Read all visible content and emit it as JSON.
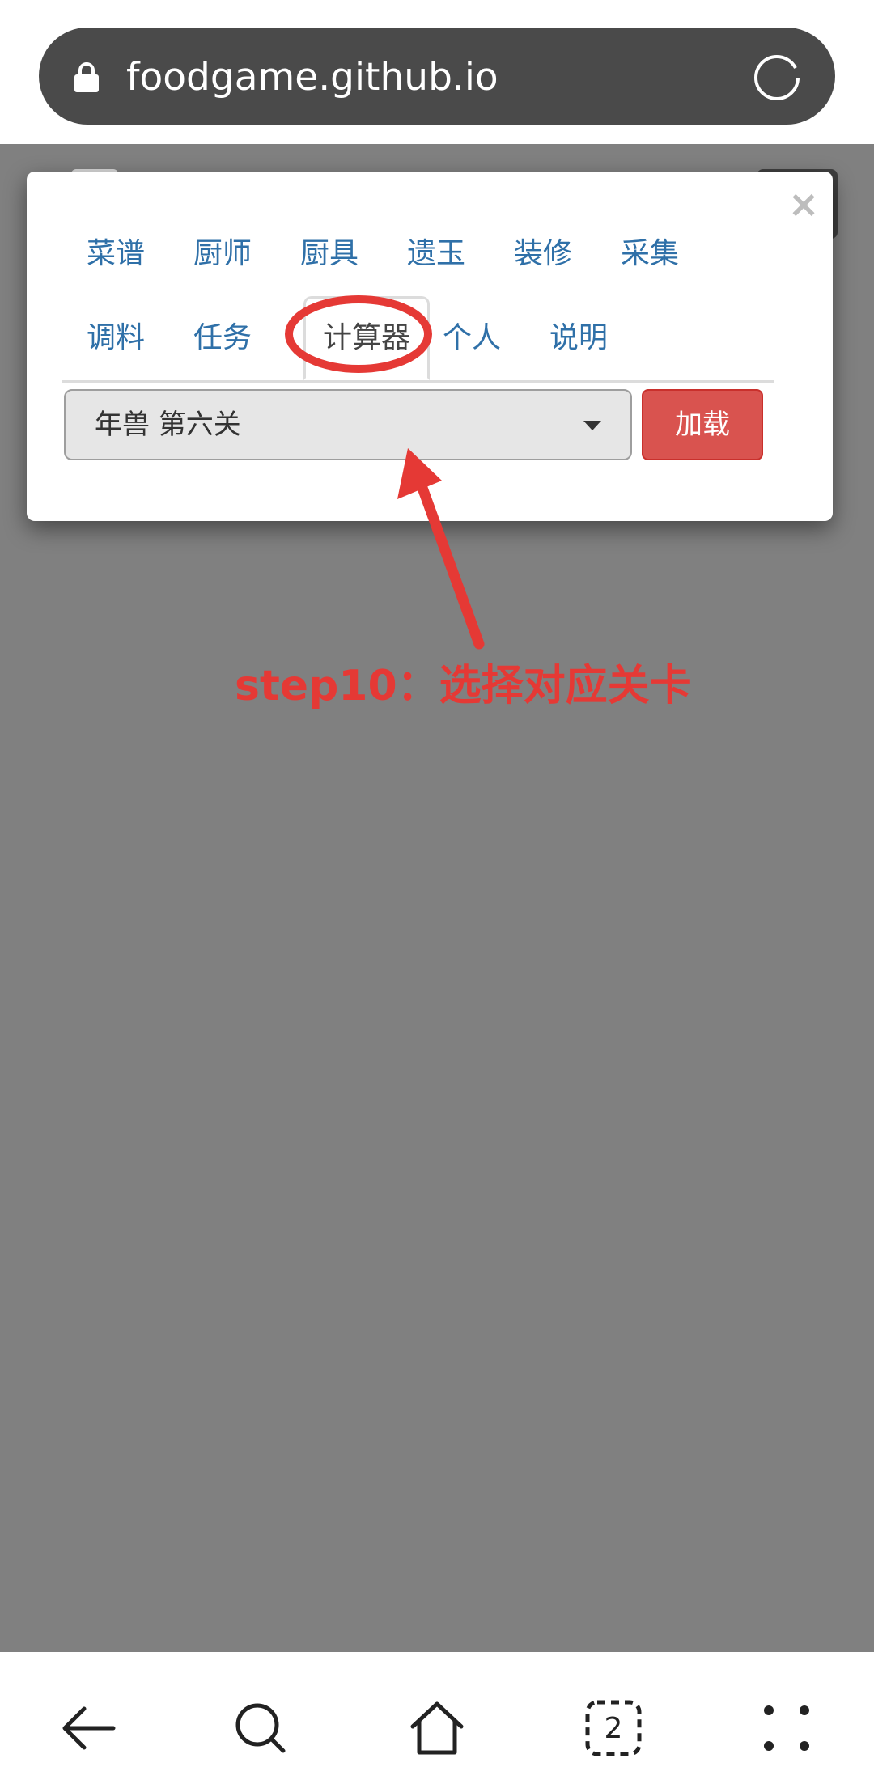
{
  "browser": {
    "url": "foodgame.github.io",
    "lock_icon": "lock-icon",
    "reload_icon": "reload-icon"
  },
  "modal": {
    "close_label": "×",
    "tabs_row1": [
      "菜谱",
      "厨师",
      "厨具",
      "遗玉",
      "装修",
      "采集"
    ],
    "tabs_row2": [
      "调料",
      "任务",
      "计算器",
      "个人",
      "说明"
    ],
    "active_tab": "计算器",
    "select_value": "年兽 第六关",
    "load_label": "加载"
  },
  "annotation": {
    "caption": "step10：选择对应关卡",
    "color": "#e53935"
  },
  "nav": {
    "icons": [
      "back-arrow-icon",
      "search-icon",
      "home-icon",
      "tabs-icon",
      "menu-icon"
    ],
    "tabs_count": "2"
  },
  "colors": {
    "overlay": "#808080",
    "tab_link": "#2f70a8",
    "danger_button": "#d9534f"
  }
}
